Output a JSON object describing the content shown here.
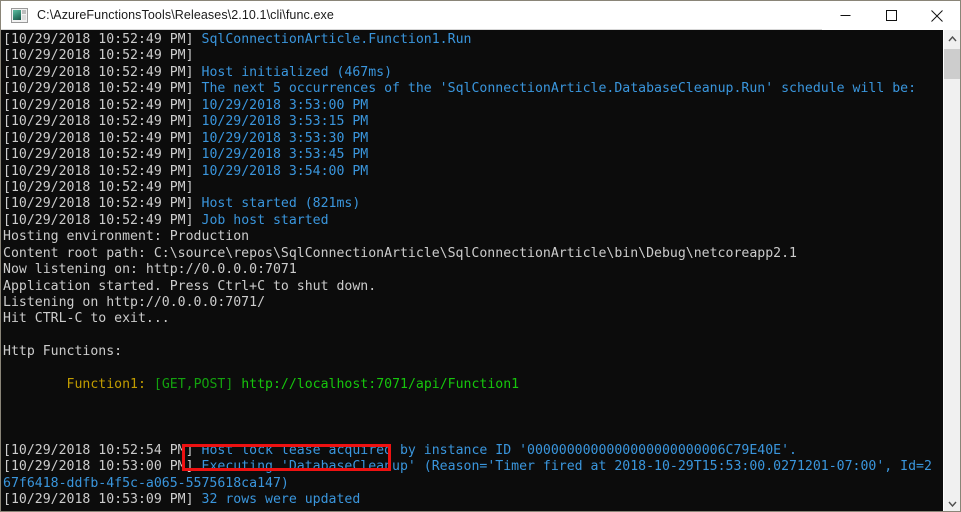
{
  "window": {
    "title": "C:\\AzureFunctionsTools\\Releases\\2.10.1\\cli\\func.exe",
    "icon": "console-icon",
    "controls": {
      "minimize": "Minimize",
      "maximize": "Maximize",
      "close": "Close"
    }
  },
  "console": {
    "background_color": "#0c0c0c",
    "timestamp_color": "#cccccc",
    "message_color": "#3a96dd",
    "lines": [
      {
        "ts": "[10/29/2018 10:52:49 PM] ",
        "msg": "SqlConnectionArticle.Function1.Run",
        "msg_class": "cy"
      },
      {
        "ts": "[10/29/2018 10:52:49 PM]",
        "msg": "",
        "msg_class": "cy"
      },
      {
        "ts": "[10/29/2018 10:52:49 PM] ",
        "msg": "Host initialized (467ms)",
        "msg_class": "cy"
      },
      {
        "ts": "[10/29/2018 10:52:49 PM] ",
        "msg": "The next 5 occurrences of the 'SqlConnectionArticle.DatabaseCleanup.Run' schedule will be:",
        "msg_class": "cy"
      },
      {
        "ts": "[10/29/2018 10:52:49 PM] ",
        "msg": "10/29/2018 3:53:00 PM",
        "msg_class": "cy"
      },
      {
        "ts": "[10/29/2018 10:52:49 PM] ",
        "msg": "10/29/2018 3:53:15 PM",
        "msg_class": "cy"
      },
      {
        "ts": "[10/29/2018 10:52:49 PM] ",
        "msg": "10/29/2018 3:53:30 PM",
        "msg_class": "cy"
      },
      {
        "ts": "[10/29/2018 10:52:49 PM] ",
        "msg": "10/29/2018 3:53:45 PM",
        "msg_class": "cy"
      },
      {
        "ts": "[10/29/2018 10:52:49 PM] ",
        "msg": "10/29/2018 3:54:00 PM",
        "msg_class": "cy"
      },
      {
        "ts": "[10/29/2018 10:52:49 PM]",
        "msg": "",
        "msg_class": "cy"
      },
      {
        "ts": "[10/29/2018 10:52:49 PM] ",
        "msg": "Host started (821ms)",
        "msg_class": "cy"
      },
      {
        "ts": "[10/29/2018 10:52:49 PM] ",
        "msg": "Job host started",
        "msg_class": "cy"
      },
      {
        "ts": "",
        "msg": "Hosting environment: Production",
        "msg_class": "wh"
      },
      {
        "ts": "",
        "msg": "Content root path: C:\\source\\repos\\SqlConnectionArticle\\SqlConnectionArticle\\bin\\Debug\\netcoreapp2.1",
        "msg_class": "wh"
      },
      {
        "ts": "",
        "msg": "Now listening on: http://0.0.0.0:7071",
        "msg_class": "wh"
      },
      {
        "ts": "",
        "msg": "Application started. Press Ctrl+C to shut down.",
        "msg_class": "wh"
      },
      {
        "ts": "",
        "msg": "Listening on http://0.0.0.0:7071/",
        "msg_class": "wh"
      },
      {
        "ts": "",
        "msg": "Hit CTRL-C to exit...",
        "msg_class": "wh"
      },
      {
        "ts": "",
        "msg": "",
        "msg_class": "wh"
      },
      {
        "ts": "",
        "msg": "Http Functions:",
        "msg_class": "wh"
      },
      {
        "ts": "",
        "msg": "",
        "msg_class": "wh"
      },
      {
        "ts": "",
        "msg": "",
        "msg_class": "wh"
      },
      {
        "ts": "",
        "msg": "",
        "msg_class": "wh"
      },
      {
        "ts": "[10/29/2018 10:52:54 PM] ",
        "msg": "Host lock lease acquired by instance ID '0000000000000000000000006C79E40E'.",
        "msg_class": "cy"
      },
      {
        "ts": "[10/29/2018 10:53:00 PM] ",
        "msg": "Executing 'DatabaseCleanup' (Reason='Timer fired at 2018-10-29T15:53:00.0271201-07:00', Id=2",
        "msg_class": "cy"
      },
      {
        "ts": "",
        "msg": "67f6418-ddfb-4f5c-a065-5575618ca147)",
        "msg_class": "cy"
      },
      {
        "ts": "[10/29/2018 10:53:09 PM] ",
        "msg": "32 rows were updated",
        "msg_class": "cy"
      }
    ],
    "http_functions": {
      "indent": "        ",
      "name": "Function1: ",
      "methods": "[GET,POST] ",
      "url": "http://localhost:7071/api/Function1",
      "name_color": "#c19c00",
      "methods_color": "#13a10e",
      "url_color": "#16c60c"
    }
  },
  "annotation": {
    "type": "highlight-rectangle",
    "color": "#ee1111",
    "target_text": "32 rows were updated"
  },
  "scrollbar": {
    "up_arrow": "chevron-up-icon",
    "down_arrow": "chevron-down-icon",
    "thumb_color": "#cdcdcd",
    "track_color": "#f0f0f0"
  }
}
